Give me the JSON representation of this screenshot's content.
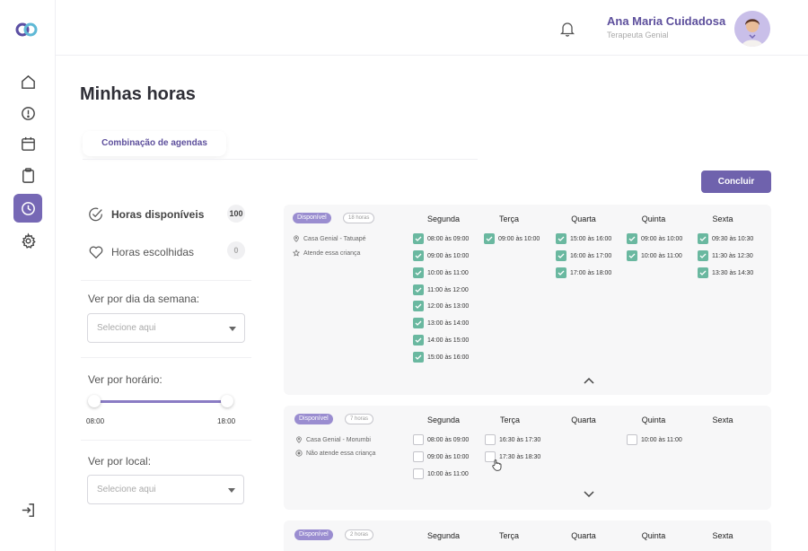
{
  "header": {
    "user_name": "Ana Maria Cuidadosa",
    "user_role": "Terapeuta Genial"
  },
  "sidebar": {
    "items": [
      {
        "icon": "home-icon",
        "active": false
      },
      {
        "icon": "alert-icon",
        "active": false
      },
      {
        "icon": "calendar-icon",
        "active": false
      },
      {
        "icon": "clipboard-icon",
        "active": false
      },
      {
        "icon": "clock-icon",
        "active": true
      },
      {
        "icon": "gear-icon",
        "active": false
      }
    ],
    "logout_icon": "logout-icon"
  },
  "page": {
    "title": "Minhas horas",
    "tab": "Combinação de agendas",
    "conclude_button": "Concluir"
  },
  "filters": {
    "available_label": "Horas disponíveis",
    "available_count": "100",
    "chosen_label": "Horas escolhidas",
    "chosen_count": "0",
    "weekday_label": "Ver por dia da semana:",
    "weekday_placeholder": "Selecione aqui",
    "time_label": "Ver por horário:",
    "time_min": "08:00",
    "time_max": "18:00",
    "location_label": "Ver por local:",
    "location_placeholder": "Selecione aqui"
  },
  "days": [
    "Segunda",
    "Terça",
    "Quarta",
    "Quinta",
    "Sexta"
  ],
  "cards": [
    {
      "status": "Disponível",
      "hours": "18 horas",
      "location": "Casa Genial - Tatuapé",
      "note": "Atende essa criança",
      "slots": [
        [
          "08:00 às 09:00",
          "09:00 às 10:00",
          "10:00 às 11:00",
          "11:00 às 12:00",
          "12:00 às 13:00",
          "13:00 às 14:00",
          "14:00 às 15:00",
          "15:00 às 16:00"
        ],
        [
          "09:00 às 10:00"
        ],
        [
          "15:00 às 16:00",
          "16:00 às 17:00",
          "17:00 às 18:00"
        ],
        [
          "09:00 às 10:00",
          "10:00 às 11:00"
        ],
        [
          "09:30 às 10:30",
          "11:30 às 12:30",
          "13:30 às 14:30"
        ]
      ]
    },
    {
      "status": "Disponível",
      "hours": "7 horas",
      "location": "Casa Genial - Morumbi",
      "note": "Não atende essa criança",
      "slots": [
        [
          "08:00 às 09:00",
          "09:00 às 10:00",
          "10:00 às 11:00"
        ],
        [
          "16:30 às 17:30",
          "17:30 às 18:30"
        ],
        [],
        [
          "10:00 às 11:00"
        ],
        []
      ]
    },
    {
      "status": "Disponível",
      "hours": "2 horas"
    }
  ]
}
